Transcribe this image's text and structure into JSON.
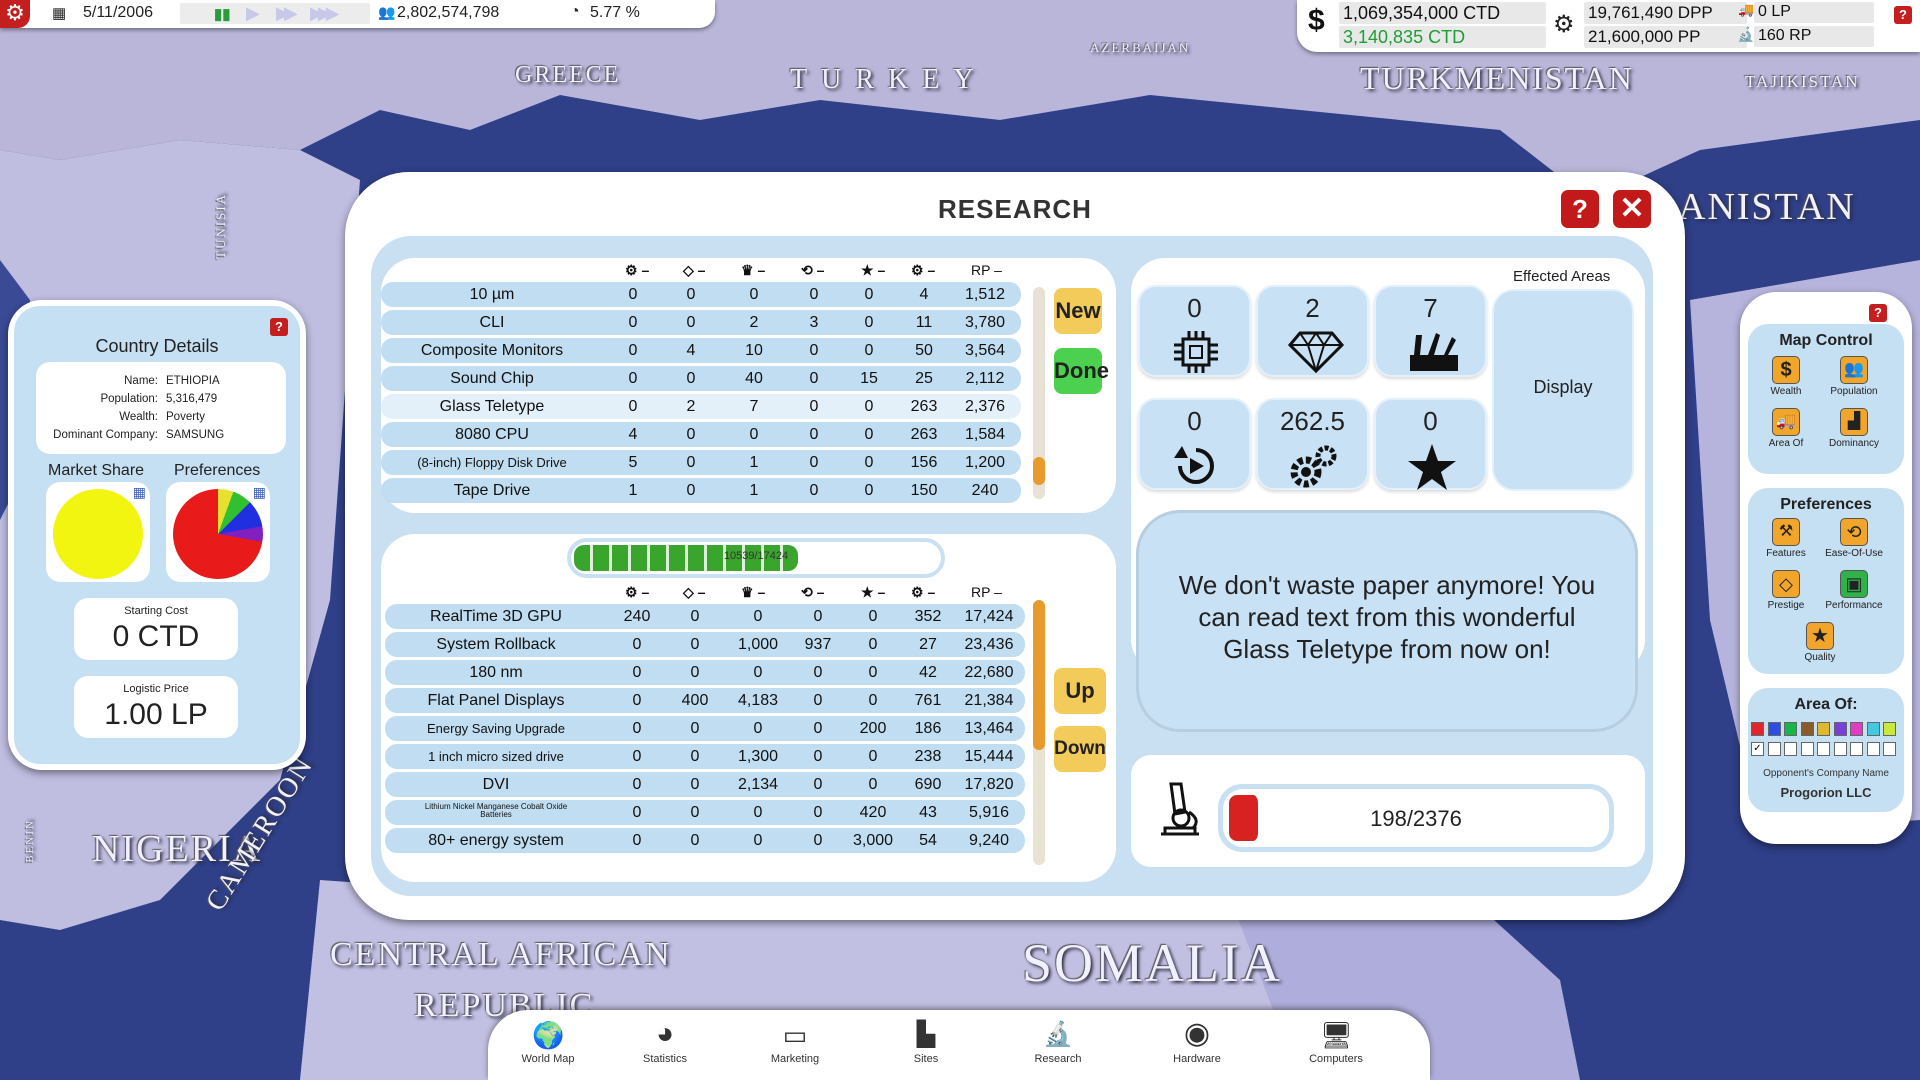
{
  "topbar": {
    "date": "5/11/2006",
    "population": "2,802,574,798",
    "rate": "5.77 %",
    "money": "1,069,354,000 CTD",
    "money_income": "3,140,835 CTD",
    "dpp": "19,761,490 DPP",
    "pp": "21,600,000 PP",
    "lp": "0 LP",
    "rp": "160 RP"
  },
  "map_labels": {
    "greece": "GREECE",
    "turkey": "TURKEY",
    "azerbaijan": "AZERBAIJAN",
    "turkmenistan": "TURKMENISTAN",
    "tajikistan": "TAJIKISTAN",
    "afghanistan": "ANISTAN",
    "tunisia": "TUNISIA",
    "nigeria": "NIGERIA",
    "cameroon": "CAMEROON",
    "car1": "CENTRAL AFRICAN",
    "car2": "REPUBLIC",
    "somalia": "SOMALIA",
    "benin": "BENIN"
  },
  "country": {
    "title": "Country Details",
    "name_label": "Name:",
    "name": "ETHIOPIA",
    "pop_label": "Population:",
    "pop": "5,316,479",
    "wealth_label": "Wealth:",
    "wealth": "Poverty",
    "company_label": "Dominant Company:",
    "company": "SAMSUNG",
    "market_share_label": "Market Share",
    "preferences_label": "Preferences",
    "starting_cost_label": "Starting Cost",
    "starting_cost": "0 CTD",
    "logistic_label": "Logistic Price",
    "logistic": "1.00 LP",
    "help": "?"
  },
  "research": {
    "title": "RESEARCH",
    "help": "?",
    "rp_header": "RP",
    "new_label": "New",
    "done_label": "Done",
    "up_label": "Up",
    "down_label": "Down",
    "progress_text": "10539/17424",
    "progress_fraction": 0.605,
    "completed": [
      {
        "name": "10 µm",
        "v": [
          "0",
          "0",
          "0",
          "0",
          "0",
          "4",
          "1,512"
        ]
      },
      {
        "name": "CLI",
        "v": [
          "0",
          "0",
          "2",
          "3",
          "0",
          "11",
          "3,780"
        ]
      },
      {
        "name": "Composite Monitors",
        "v": [
          "0",
          "4",
          "10",
          "0",
          "0",
          "50",
          "3,564"
        ]
      },
      {
        "name": "Sound Chip",
        "v": [
          "0",
          "0",
          "40",
          "0",
          "15",
          "25",
          "2,112"
        ]
      },
      {
        "name": "Glass Teletype",
        "v": [
          "0",
          "2",
          "7",
          "0",
          "0",
          "263",
          "2,376"
        ]
      },
      {
        "name": "8080 CPU",
        "v": [
          "4",
          "0",
          "0",
          "0",
          "0",
          "263",
          "1,584"
        ]
      },
      {
        "name": "(8-inch) Floppy Disk Drive",
        "v": [
          "5",
          "0",
          "1",
          "0",
          "0",
          "156",
          "1,200"
        ]
      },
      {
        "name": "Tape Drive",
        "v": [
          "1",
          "0",
          "1",
          "0",
          "0",
          "150",
          "240"
        ]
      }
    ],
    "queue": [
      {
        "name": "RealTime 3D GPU",
        "v": [
          "240",
          "0",
          "0",
          "0",
          "0",
          "352",
          "17,424"
        ]
      },
      {
        "name": "System Rollback",
        "v": [
          "0",
          "0",
          "1,000",
          "937",
          "0",
          "27",
          "23,436"
        ]
      },
      {
        "name": "180 nm",
        "v": [
          "0",
          "0",
          "0",
          "0",
          "0",
          "42",
          "22,680"
        ]
      },
      {
        "name": "Flat Panel Displays",
        "v": [
          "0",
          "400",
          "4,183",
          "0",
          "0",
          "761",
          "21,384"
        ]
      },
      {
        "name": "Energy Saving Upgrade",
        "v": [
          "0",
          "0",
          "0",
          "0",
          "200",
          "186",
          "13,464"
        ]
      },
      {
        "name": "1 inch micro sized drive",
        "v": [
          "0",
          "0",
          "1,300",
          "0",
          "0",
          "238",
          "15,444"
        ]
      },
      {
        "name": "DVI",
        "v": [
          "0",
          "0",
          "2,134",
          "0",
          "0",
          "690",
          "17,820"
        ]
      },
      {
        "name": "Lithium Nickel Manganese Cobalt Oxide Batteries",
        "v": [
          "0",
          "0",
          "0",
          "0",
          "420",
          "43",
          "5,916"
        ]
      },
      {
        "name": "80+ energy system",
        "v": [
          "0",
          "0",
          "0",
          "0",
          "3,000",
          "54",
          "9,240"
        ]
      }
    ],
    "effected_label": "Effected Areas",
    "stats": {
      "performance": "0",
      "prestige": "2",
      "features": "7",
      "ease": "0",
      "gears": "262.5",
      "quality": "0"
    },
    "display_label": "Display",
    "description": "We don't waste paper anymore! You can read text from this wonderful Glass Teletype from now on!",
    "rp_progress": "198/2376",
    "rp_fraction": 0.083
  },
  "mapcontrol": {
    "help": "?",
    "title": "Map Control",
    "wealth": "Wealth",
    "population": "Population",
    "area_of": "Area Of",
    "dominancy": "Dominancy",
    "pref_title": "Preferences",
    "features": "Features",
    "ease": "Ease-Of-Use",
    "prestige": "Prestige",
    "performance": "Performance",
    "quality": "Quality",
    "areaof_title": "Area Of:",
    "opp_label": "Opponent's Company Name",
    "opp_name": "Progorion LLC",
    "swatches": [
      "#e0252b",
      "#2d4ee5",
      "#18b54a",
      "#8a5b2a",
      "#e0b82c",
      "#7a3fd8",
      "#e23cc6",
      "#43c8e0",
      "#c9e83a"
    ]
  },
  "bottom": {
    "world_map": "World Map",
    "statistics": "Statistics",
    "marketing": "Marketing",
    "sites": "Sites",
    "research": "Research",
    "hardware": "Hardware",
    "computers": "Computers"
  }
}
